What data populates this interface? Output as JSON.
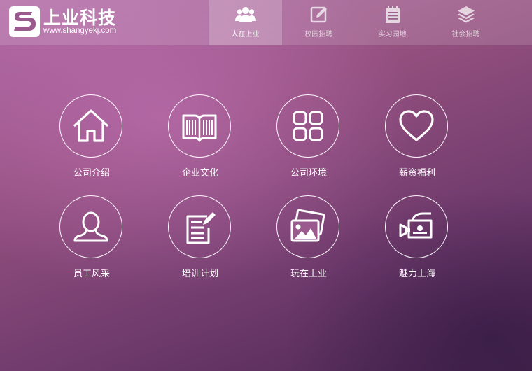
{
  "brand": {
    "title": "上业科技",
    "url": "www.shangyekj.com"
  },
  "nav": {
    "items": [
      {
        "label": "人在上业",
        "icon": "people-icon",
        "active": true
      },
      {
        "label": "校园招聘",
        "icon": "edit-icon",
        "active": false
      },
      {
        "label": "实习园地",
        "icon": "notepad-icon",
        "active": false
      },
      {
        "label": "社会招聘",
        "icon": "layers-icon",
        "active": false
      }
    ]
  },
  "tiles": [
    {
      "label": "公司介绍",
      "icon": "home-icon"
    },
    {
      "label": "企业文化",
      "icon": "book-icon"
    },
    {
      "label": "公司环境",
      "icon": "grid-icon"
    },
    {
      "label": "薪资福利",
      "icon": "heart-icon"
    },
    {
      "label": "员工风采",
      "icon": "person-icon"
    },
    {
      "label": "培训计划",
      "icon": "document-edit-icon"
    },
    {
      "label": "玩在上业",
      "icon": "photos-icon"
    },
    {
      "label": "魅力上海",
      "icon": "video-camera-icon"
    }
  ],
  "colors": {
    "background_top": "#b068a4",
    "background_bottom": "#4a2650",
    "foreground": "#ffffff"
  }
}
